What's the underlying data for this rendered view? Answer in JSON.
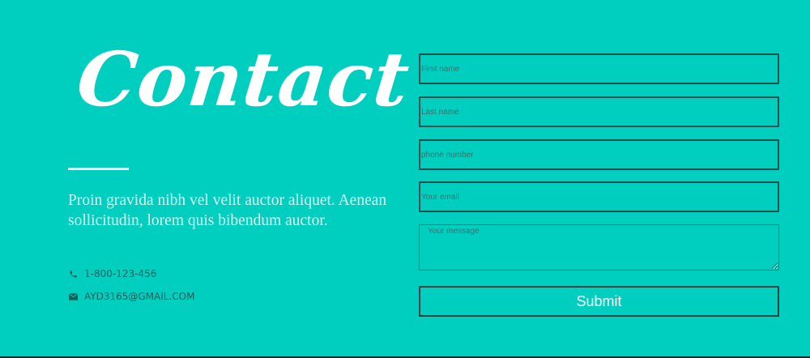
{
  "heading": {
    "title": "Contact"
  },
  "intro": {
    "text": "Proin gravida nibh vel velit auctor aliquet. Aenean sollicitudin, lorem quis bibendum auctor."
  },
  "contact_info": {
    "phone": "1-800-123-456",
    "email": "AYD3165@GMAIL.COM",
    "phone_icon": "phone-icon",
    "email_icon": "envelope-icon"
  },
  "form": {
    "first_name_placeholder": "First name",
    "last_name_placeholder": "Last name",
    "phone_placeholder": "phone number",
    "email_placeholder": "Your email",
    "message_placeholder": "Your message",
    "submit_label": "Submit"
  },
  "colors": {
    "background": "#00cfc0",
    "heading": "#ffffff",
    "border": "#1f4f4b"
  }
}
